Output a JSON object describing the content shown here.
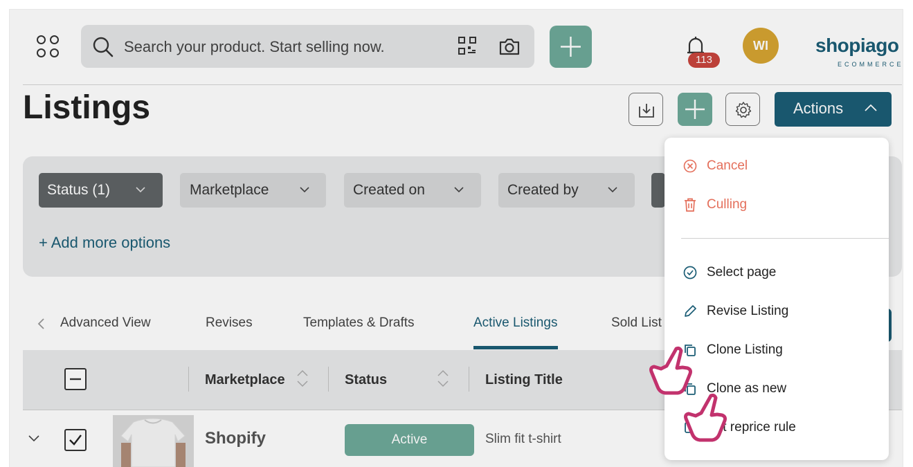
{
  "search": {
    "placeholder": "Search your product. Start selling now."
  },
  "notifications": {
    "count": "113"
  },
  "user": {
    "initials": "WI"
  },
  "brand": {
    "name": "shopiago",
    "sub": "ECOMMERCE"
  },
  "page": {
    "title": "Listings"
  },
  "toolbar": {
    "actions_label": "Actions"
  },
  "filters": {
    "chips": [
      "Status (1)",
      "Marketplace",
      "Created on",
      "Created by"
    ],
    "add_more": "+ Add more options"
  },
  "tabs": [
    "Advanced View",
    "Revises",
    "Templates & Drafts",
    "Active Listings",
    "Sold List"
  ],
  "active_tab": "Active Listings",
  "table": {
    "headers": [
      "Marketplace",
      "Status",
      "Listing Title"
    ],
    "rows": [
      {
        "marketplace": "Shopify",
        "status": "Active",
        "title": "Slim fit t-shirt"
      }
    ]
  },
  "actions_menu": {
    "destructive": [
      "Cancel",
      "Culling"
    ],
    "items": [
      "Select page",
      "Revise Listing",
      "Clone Listing",
      "Clone as new",
      "Set reprice rule"
    ]
  },
  "colors": {
    "primary": "#1b5d75",
    "accent_green": "#6ea99a",
    "danger": "#e46f5b",
    "badge": "#c8443d",
    "avatar": "#d6a431",
    "cursor": "#c2326d"
  }
}
